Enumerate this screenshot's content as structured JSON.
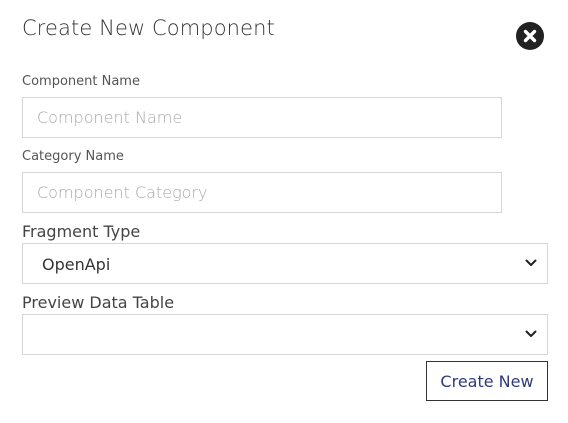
{
  "dialog": {
    "title": "Create New Component"
  },
  "form": {
    "component_name": {
      "label": "Component Name",
      "placeholder": "Component Name",
      "value": ""
    },
    "category_name": {
      "label": "Category Name",
      "placeholder": "Component Category",
      "value": ""
    },
    "fragment_type": {
      "label": "Fragment Type",
      "selected": "OpenApi"
    },
    "preview_data_table": {
      "label": "Preview Data Table",
      "selected": ""
    }
  },
  "actions": {
    "create_label": "Create New"
  },
  "icons": {
    "close": "close-circle-icon",
    "dropdown": "chevron-down-icon"
  }
}
